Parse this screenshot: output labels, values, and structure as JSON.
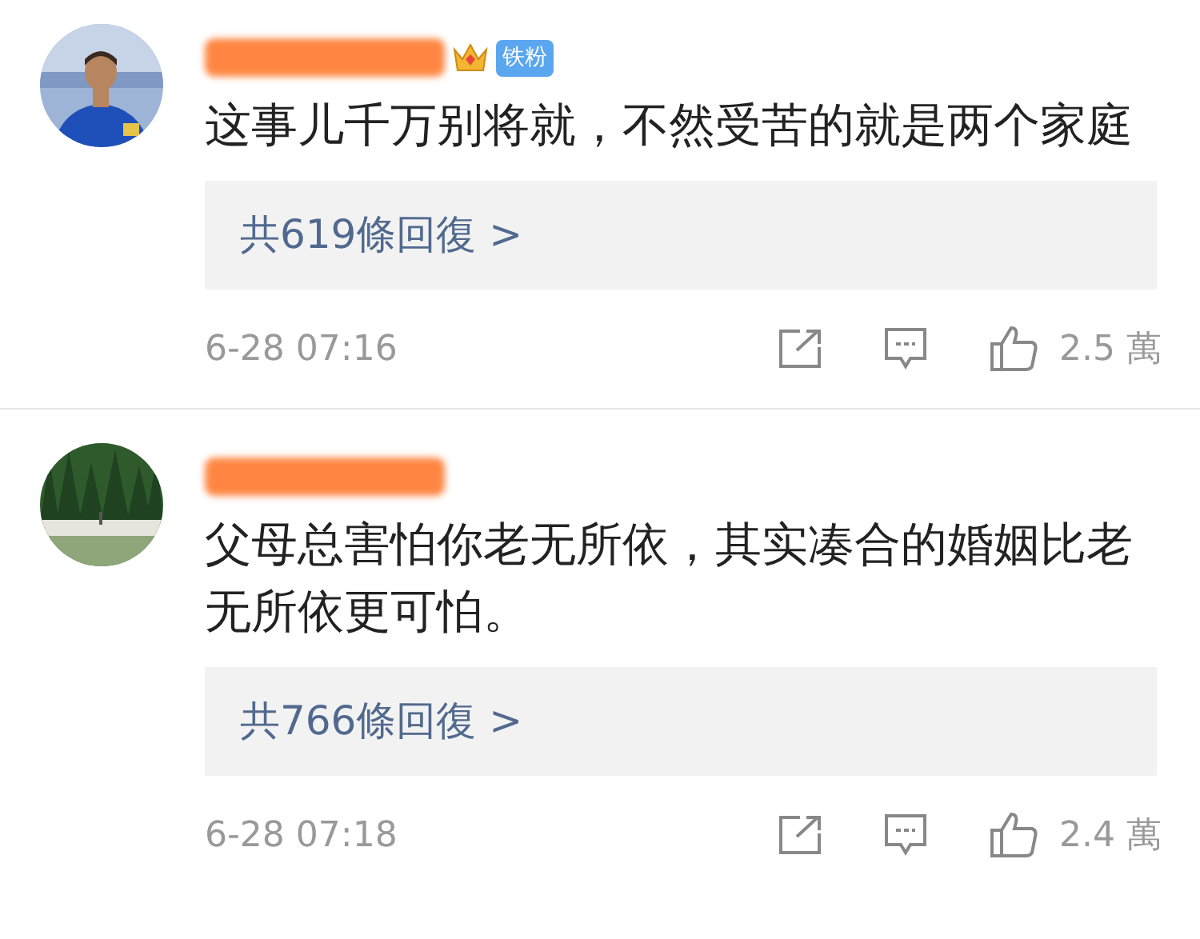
{
  "comments": [
    {
      "name_redacted": true,
      "badge": "铁粉",
      "text": "这事儿千万别将就，不然受苦的就是两个家庭",
      "replies": "共619條回復 >",
      "time": "6-28 07:16",
      "likes": "2.5 萬"
    },
    {
      "name_redacted": true,
      "text": "父母总害怕你老无所依，其实凑合的婚姻比老无所依更可怕。",
      "replies": "共766條回復 >",
      "time": "6-28 07:18",
      "likes": "2.4 萬"
    }
  ]
}
